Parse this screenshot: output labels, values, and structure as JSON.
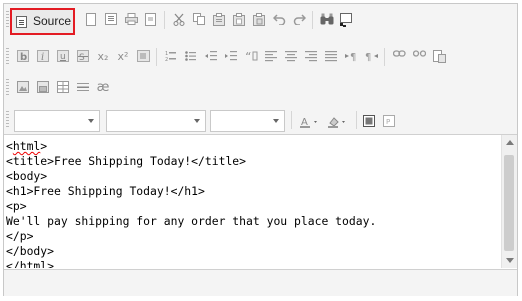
{
  "toolbar": {
    "source_label": "Source",
    "rows": [
      {
        "name": "document",
        "buttons": [
          "new-page-icon",
          "templates-icon",
          "print-icon",
          "preview-icon",
          "cut-icon",
          "copy-icon",
          "paste-icon",
          "paste-text-icon",
          "paste-word-icon",
          "undo-icon",
          "redo-icon",
          "find-icon",
          "select-all-icon"
        ]
      },
      {
        "name": "basicstyles",
        "buttons": [
          "bold-icon",
          "italic-icon",
          "underline-icon",
          "strike-icon",
          "subscript-icon",
          "superscript-icon",
          "remove-format-icon",
          "numbered-list-icon",
          "bulleted-list-icon",
          "outdent-icon",
          "indent-icon",
          "blockquote-icon",
          "align-left-icon",
          "align-center-icon",
          "align-right-icon",
          "justify-icon",
          "ltr-icon",
          "rtl-icon",
          "link-icon",
          "unlink-icon",
          "anchor-icon"
        ]
      },
      {
        "name": "insert",
        "buttons": [
          "image-icon",
          "flash-icon",
          "table-icon",
          "horizontal-rule-icon",
          "special-char-icon"
        ]
      }
    ],
    "glyphs": {
      "subscript": "x₂",
      "superscript": "x²",
      "special_char": "æ"
    },
    "combos": [
      "",
      "",
      ""
    ]
  },
  "source_code": "<html>\n<title>Free Shipping Today!</title>\n<body>\n<h1>Free Shipping Today!</h1>\n<p>\nWe'll pay shipping for any order that you place today.\n</p>\n</body>\n</html>",
  "source_first_tag": "html",
  "colors": {
    "highlight_border": "#e31b23",
    "toolbar_bg": "#f4f4f4",
    "icon_gray": "#8c8c8c"
  }
}
